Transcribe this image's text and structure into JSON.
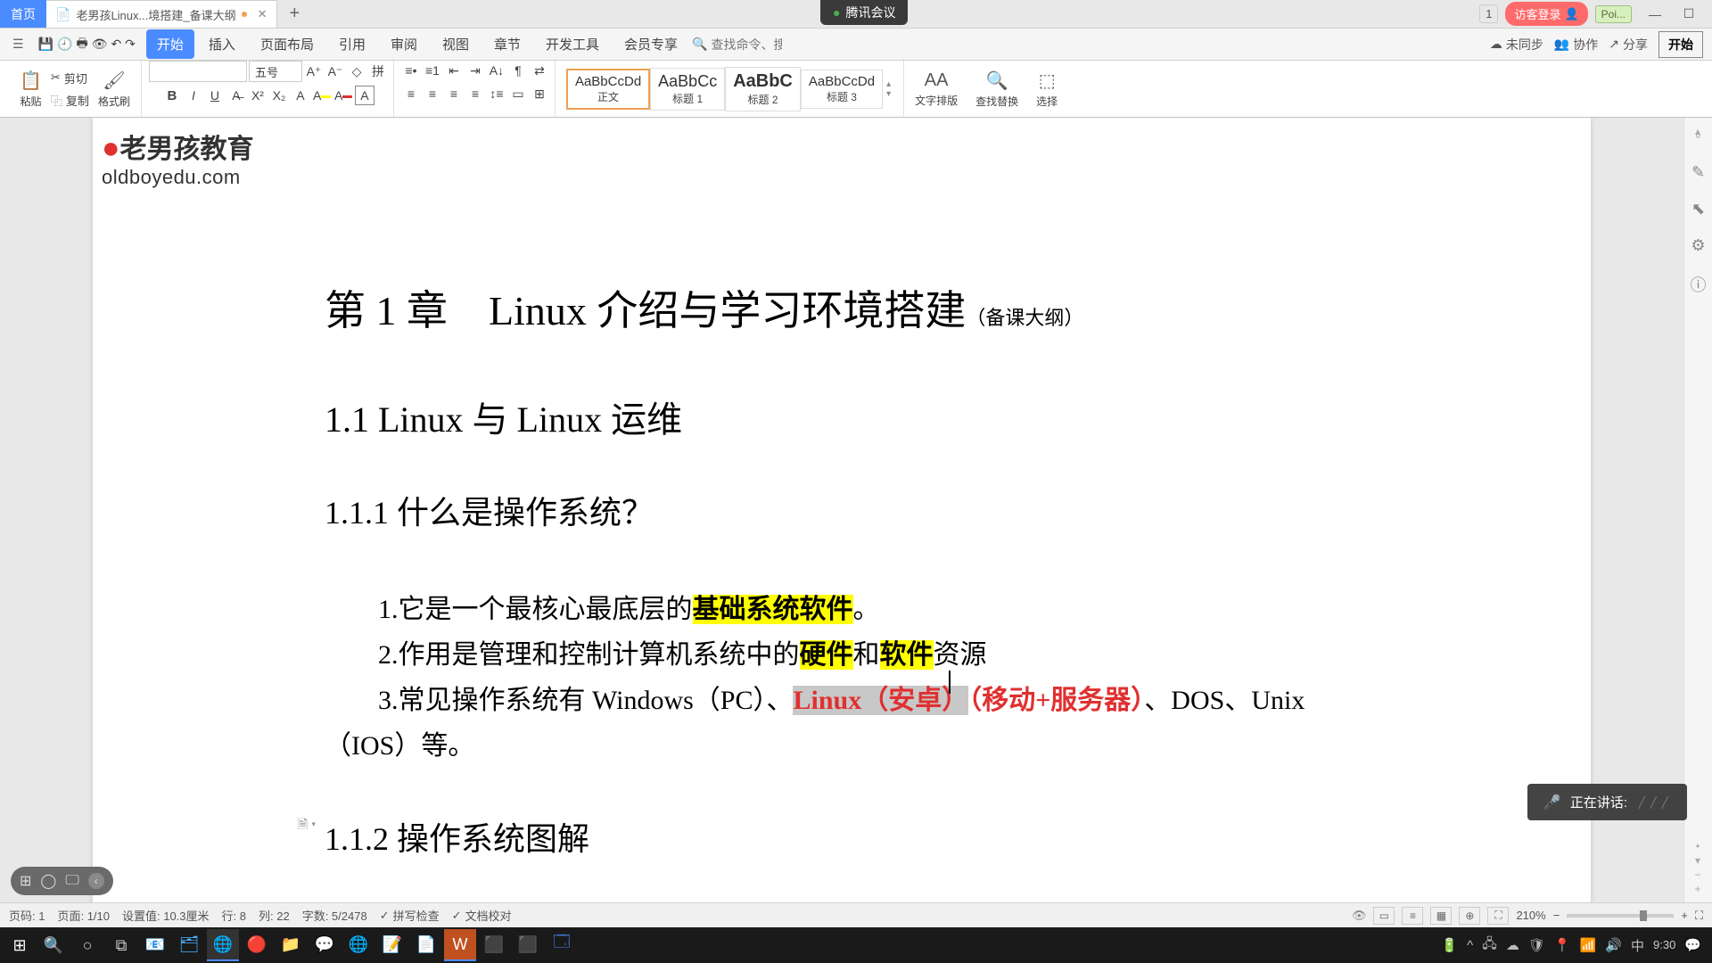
{
  "meeting": {
    "label": "腾讯会议"
  },
  "tabs": {
    "home": "首页",
    "doc_title": "老男孩Linux...境搭建_备课大纲",
    "pages": "1"
  },
  "login": {
    "guest": "访客登录"
  },
  "poi": "Poi...",
  "start_btn": "开始",
  "menu": {
    "file": "文件",
    "items": [
      "开始",
      "插入",
      "页面布局",
      "引用",
      "审阅",
      "视图",
      "章节",
      "开发工具",
      "会员专享"
    ],
    "search_placeholder": "查找命令、搜索模板"
  },
  "menubar_right": {
    "unsync": "未同步",
    "collab": "协作",
    "share": "分享"
  },
  "ribbon": {
    "paste": "粘贴",
    "cut": "剪切",
    "copy": "复制",
    "format_painter": "格式刷",
    "font_name": "",
    "font_size": "五号",
    "styles": [
      {
        "preview": "AaBbCcDd",
        "name": "正文"
      },
      {
        "preview": "AaBbCc",
        "name": "标题 1"
      },
      {
        "preview": "AaBbC",
        "name": "标题 2"
      },
      {
        "preview": "AaBbCcDd",
        "name": "标题 3"
      }
    ],
    "text_wrap": "文字排版",
    "find_replace": "查找替换",
    "select": "选择"
  },
  "doc": {
    "chapter": "第 1 章　Linux 介绍与学习环境搭建",
    "chapter_note": "（备课大纲）",
    "h11": "1.1 Linux 与 Linux 运维",
    "h111": "1.1.1 什么是操作系统？",
    "l1_pre": "1.它是一个最核心最底层的",
    "l1_hl": "基础系统软件",
    "l1_post": "。",
    "l2_pre": "2.作用是管理和控制计算机系统中的",
    "l2_hl1": "硬件",
    "l2_mid": "和",
    "l2_hl2": "软件",
    "l2_post": "资源",
    "l3_pre": "3.常见操作系统有 Windows（PC）、",
    "l3_red1": "Linux（安卓）",
    "l3_red2": "（移动+服务器）",
    "l3_post": "、DOS、Unix（IOS）等。",
    "h112": "1.1.2  操作系统图解"
  },
  "watermark": {
    "main": "老男孩教育",
    "sub": "oldboyedu.com"
  },
  "speaking": {
    "label": "正在讲话:"
  },
  "status": {
    "page": "页码: 1",
    "pages": "页面: 1/10",
    "ruler": "设置值: 10.3厘米",
    "row": "行: 8",
    "col": "列: 22",
    "words": "字数: 5/2478",
    "spell": "拼写检查",
    "proofread": "文档校对",
    "zoom": "210%"
  },
  "taskbar": {
    "time": "9:30"
  }
}
